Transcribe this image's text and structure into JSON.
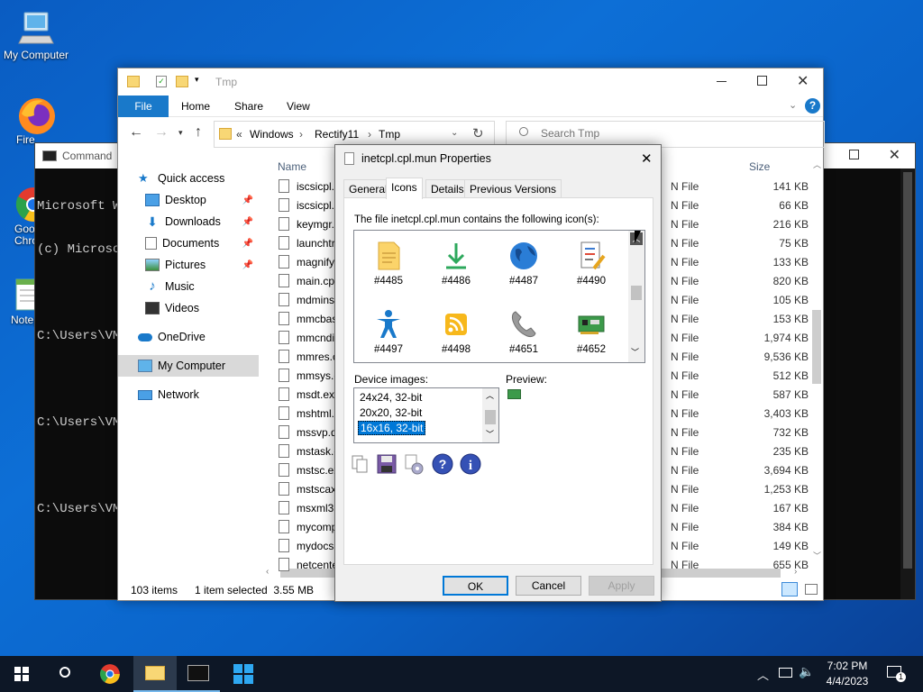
{
  "desktop": {
    "icons": [
      {
        "label": "My Computer"
      },
      {
        "label": "Fire"
      },
      {
        "label": "Goo Chro"
      },
      {
        "label": "Notep"
      }
    ]
  },
  "cmd": {
    "title": "Command",
    "lines": [
      "Microsoft Wi",
      "(c) Microso",
      "",
      "C:\\Users\\VM",
      "",
      "C:\\Users\\VM",
      "",
      "C:\\Users\\VM"
    ]
  },
  "explorer": {
    "title": "Tmp",
    "ribbon": {
      "file": "File",
      "home": "Home",
      "share": "Share",
      "view": "View"
    },
    "address": {
      "prefix": "«",
      "parts": [
        "Windows",
        "Rectify11",
        "Tmp"
      ]
    },
    "search_placeholder": "Search Tmp",
    "nav": [
      {
        "label": "Quick access"
      },
      {
        "label": "Desktop"
      },
      {
        "label": "Downloads"
      },
      {
        "label": "Documents"
      },
      {
        "label": "Pictures"
      },
      {
        "label": "Music"
      },
      {
        "label": "Videos"
      },
      {
        "label": "OneDrive"
      },
      {
        "label": "My Computer"
      },
      {
        "label": "Network"
      }
    ],
    "columns": {
      "name": "Name",
      "size": "Size"
    },
    "files": [
      {
        "name": "iscsicpl.",
        "type": "N File",
        "size": "141 KB"
      },
      {
        "name": "iscsicpl.",
        "type": "N File",
        "size": "66 KB"
      },
      {
        "name": "keymgr.",
        "type": "N File",
        "size": "216 KB"
      },
      {
        "name": "launchtr",
        "type": "N File",
        "size": "75 KB"
      },
      {
        "name": "magnify",
        "type": "N File",
        "size": "133 KB"
      },
      {
        "name": "main.cp",
        "type": "N File",
        "size": "820 KB"
      },
      {
        "name": "mdmins",
        "type": "N File",
        "size": "105 KB"
      },
      {
        "name": "mmcbas",
        "type": "N File",
        "size": "153 KB"
      },
      {
        "name": "mmcndi",
        "type": "N File",
        "size": "1,974 KB"
      },
      {
        "name": "mmres.c",
        "type": "N File",
        "size": "9,536 KB"
      },
      {
        "name": "mmsys.c",
        "type": "N File",
        "size": "512 KB"
      },
      {
        "name": "msdt.ex",
        "type": "N File",
        "size": "587 KB"
      },
      {
        "name": "mshtml.",
        "type": "N File",
        "size": "3,403 KB"
      },
      {
        "name": "mssvp.d",
        "type": "N File",
        "size": "732 KB"
      },
      {
        "name": "mstask.c",
        "type": "N File",
        "size": "235 KB"
      },
      {
        "name": "mstsc.ex",
        "type": "N File",
        "size": "3,694 KB"
      },
      {
        "name": "mstscax",
        "type": "N File",
        "size": "1,253 KB"
      },
      {
        "name": "msxml3.",
        "type": "N File",
        "size": "167 KB"
      },
      {
        "name": "mycomp",
        "type": "N File",
        "size": "384 KB"
      },
      {
        "name": "mydocs.",
        "type": "N File",
        "size": "149 KB"
      },
      {
        "name": "netcente",
        "type": "N File",
        "size": "655 KB"
      }
    ],
    "status": {
      "count": "103 items",
      "selected": "1 item selected  3.55 MB"
    }
  },
  "dialog": {
    "title": "inetcpl.cpl.mun Properties",
    "tabs": [
      "General",
      "Icons",
      "Details",
      "Previous Versions"
    ],
    "contains_label": "The file inetcpl.cpl.mun contains the following icon(s):",
    "icons": [
      {
        "label": "#4485",
        "icon": "document-icon"
      },
      {
        "label": "#4486",
        "icon": "download-arrow-icon"
      },
      {
        "label": "#4487",
        "icon": "globe-icon"
      },
      {
        "label": "#4490",
        "icon": "checklist-icon"
      },
      {
        "label": "#4497",
        "icon": "accessibility-icon"
      },
      {
        "label": "#4498",
        "icon": "rss-icon"
      },
      {
        "label": "#4651",
        "icon": "phone-icon"
      },
      {
        "label": "#4652",
        "icon": "network-card-icon"
      }
    ],
    "device_images_label": "Device images:",
    "device_images": [
      "24x24, 32-bit",
      "20x20, 32-bit",
      "16x16, 32-bit"
    ],
    "selected_image": "16x16, 32-bit",
    "preview_label": "Preview:",
    "buttons": {
      "ok": "OK",
      "cancel": "Cancel",
      "apply": "Apply"
    }
  },
  "taskbar": {
    "time": "7:02 PM",
    "date": "4/4/2023",
    "notification_count": "1"
  },
  "colors": {
    "accent": "#0078d7",
    "ribbon_file": "#1979ca",
    "selection": "#cce8ff",
    "desktop": "#0b63c9"
  }
}
